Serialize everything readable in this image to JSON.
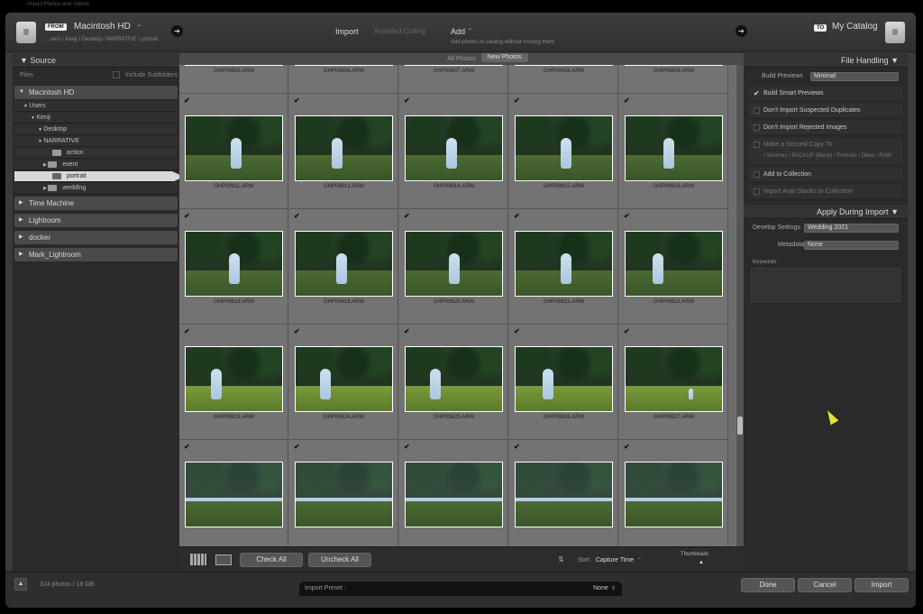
{
  "window_title": "Import Photos and Videos",
  "from": {
    "tag": "FROM",
    "source": "Macintosh HD",
    "path": "…sers / Kenji / Desktop / NARRATIVE / portrait"
  },
  "modes": {
    "import": "Import",
    "culling": "Assisted Culling",
    "add": "Add",
    "add_desc": "Add photos to catalog without moving them"
  },
  "to": {
    "tag": "TO",
    "dest": "My Catalog"
  },
  "source_panel": {
    "title": "Source",
    "files_label": "Files",
    "include_subfolders": "Include Subfolders",
    "tree": [
      {
        "label": "Macintosh HD",
        "level": "vol"
      },
      {
        "label": "Users"
      },
      {
        "label": "Kenji"
      },
      {
        "label": "Desktop"
      },
      {
        "label": "NARRATIVE"
      },
      {
        "label": "action"
      },
      {
        "label": "event"
      },
      {
        "label": "portrait"
      },
      {
        "label": "wedding"
      }
    ],
    "volumes": [
      "Time Machine",
      "Lightroom",
      "docker",
      "Mark_Lightroom"
    ]
  },
  "grid": {
    "tabs": [
      "All Photos",
      "New Photos"
    ],
    "rows": [
      [
        "GHP09605.ARW",
        "GHP09606.ARW",
        "GHP09607.ARW",
        "GHP09608.ARW",
        "GHP09609.ARW"
      ],
      [
        "GHP09611.ARW",
        "GHP09613.ARW",
        "GHP09614.ARW",
        "GHP09615.ARW",
        "GHP09616.ARW"
      ],
      [
        "GHP09618.ARW",
        "GHP09619.ARW",
        "GHP09620.ARW",
        "GHP09621.ARW",
        "GHP09622.ARW"
      ],
      [
        "GHP09623.ARW",
        "GHP09624.ARW",
        "GHP09625.ARW",
        "GHP09626.ARW",
        "GHP09627.ARW"
      ],
      [
        "",
        "",
        "",
        "",
        ""
      ]
    ]
  },
  "toolbar": {
    "check_all": "Check All",
    "uncheck_all": "Uncheck All",
    "sort_label": "Sort:",
    "sort_value": "Capture Time",
    "thumbnails": "Thumbnails"
  },
  "file_handling": {
    "title": "File Handling",
    "build_previews_label": "Build Previews",
    "build_previews_value": "Minimal",
    "options": [
      {
        "label": "Build Smart Previews",
        "checked": true
      },
      {
        "label": "Don't Import Suspected Duplicates",
        "checked": false
      },
      {
        "label": "Don't Import Rejected Images",
        "checked": false
      },
      {
        "label": "Make a Second Copy To :",
        "checked": false,
        "dim": true
      },
      {
        "label": "Add to Collection",
        "checked": false
      },
      {
        "label": "Import Auto Stacks to Collection",
        "checked": false,
        "dim": true
      }
    ],
    "second_copy_path": "/ Volumes / BACKUP (Black) / Portraits / Obee / RAW"
  },
  "apply": {
    "title": "Apply During Import",
    "develop_label": "Develop Settings",
    "develop_value": "Wedding 2021",
    "metadata_label": "Metadata",
    "metadata_value": "None",
    "keywords_label": "Keywords"
  },
  "footer": {
    "count": "324 photos / 18 GB",
    "preset_label": "Import Preset :",
    "preset_value": "None",
    "done": "Done",
    "cancel": "Cancel",
    "import": "Import"
  }
}
